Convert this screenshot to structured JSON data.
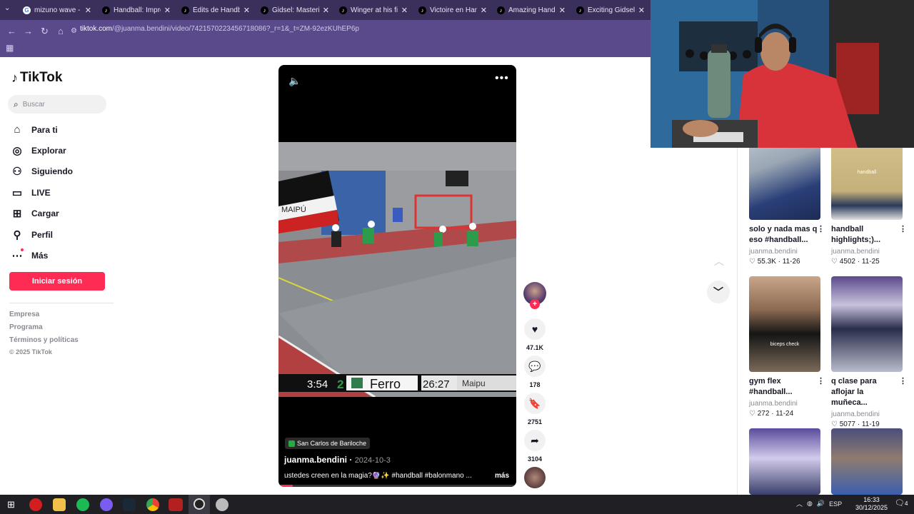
{
  "browser": {
    "tabs": [
      {
        "title": "mizuno wave - Bu",
        "icon": "google-icon"
      },
      {
        "title": "Handball: Improv",
        "icon": "tiktok-icon"
      },
      {
        "title": "Édits de Handball",
        "icon": "tiktok-icon"
      },
      {
        "title": "Gidsel: Mastering",
        "icon": "tiktok-icon"
      },
      {
        "title": "Winger at his fine",
        "icon": "tiktok-icon"
      },
      {
        "title": "Victoire en Handb",
        "icon": "tiktok-icon"
      },
      {
        "title": "Amazing Handbal",
        "icon": "tiktok-icon"
      },
      {
        "title": "Exciting Gidsel Ha",
        "icon": "tiktok-icon"
      }
    ],
    "url_domain": "tiktok.com",
    "url_path": "/@juanma.bendini/video/7421570223456718086?_r=1&_t=ZM-92ezKUhEP6p"
  },
  "sidebar": {
    "logo": "TikTok",
    "search_placeholder": "Buscar",
    "items": [
      {
        "label": "Para ti",
        "icon": "home-icon"
      },
      {
        "label": "Explorar",
        "icon": "compass-icon"
      },
      {
        "label": "Siguiendo",
        "icon": "following-icon"
      },
      {
        "label": "LIVE",
        "icon": "live-icon"
      },
      {
        "label": "Cargar",
        "icon": "upload-icon"
      },
      {
        "label": "Perfil",
        "icon": "profile-icon"
      },
      {
        "label": "Más",
        "icon": "more-icon"
      }
    ],
    "login_button": "Iniciar sesión",
    "footer": [
      "Empresa",
      "Programa",
      "Términos y políticas"
    ],
    "copyright": "© 2025 TikTok"
  },
  "video": {
    "location": "San Carlos de Bariloche",
    "author": "juanma.bendini",
    "date": "2024-10-3",
    "caption": "ustedes creen en la magia?🔮✨ #handball #balonmano ...",
    "more_label": "más",
    "scoreboard": {
      "time": "3:54",
      "home_score": "2",
      "team1": "Ferro",
      "clock": "26:27",
      "team2": "Maipu"
    },
    "banner_text": "MAIPÚ"
  },
  "actions": {
    "likes": "47.1K",
    "comments": "178",
    "saves": "2751",
    "shares": "3104"
  },
  "grid": [
    {
      "title": "solo y nada mas q eso #handball...",
      "user": "juanma.bendini",
      "likes": "55.3K",
      "date": "11-26"
    },
    {
      "title": "handball highlights;)...",
      "user": "juanma.bendini",
      "likes": "4502",
      "date": "11-25",
      "overlay": "handball"
    },
    {
      "title": "gym flex #handball...",
      "user": "juanma.bendini",
      "likes": "272",
      "date": "11-24",
      "overlay": "biceps check"
    },
    {
      "title": "q clase para aflojar la muñeca...",
      "user": "juanma.bendini",
      "likes": "5077",
      "date": "11-19"
    }
  ],
  "taskbar": {
    "lang": "ESP",
    "time": "16:33",
    "date": "30/12/2025",
    "notif": "4"
  },
  "colors": {
    "accent": "#fe2c55",
    "browser_tab": "#3b2f5c",
    "browser_bar": "#5a4a8c"
  }
}
